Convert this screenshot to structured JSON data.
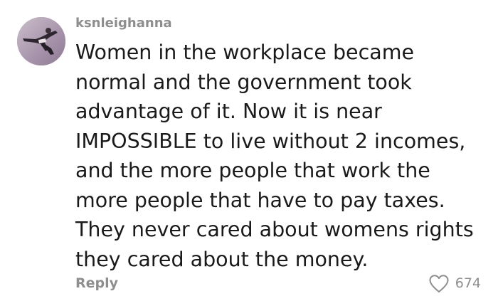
{
  "comment": {
    "username": "ksnleighanna",
    "text": "Women in the workplace became\nnormal and the government took\nadvantage of it. Now it is near\nIMPOSSIBLE to live without 2 incomes,\nand the more people that work the\nmore people that have to pay taxes.\nThey never cared about womens rights\nthey cared about the money.",
    "reply_label": "Reply",
    "like_count": "674",
    "avatar_icon": "user-avatar-photo",
    "heart_icon": "heart-outline-icon"
  },
  "colors": {
    "username": "#8e8e8e",
    "text": "#1a1a1a",
    "meta": "#8e8e8e",
    "background": "#ffffff"
  }
}
